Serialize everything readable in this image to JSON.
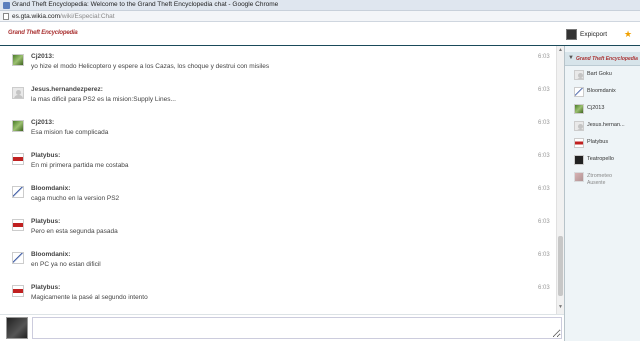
{
  "browser": {
    "title": "Grand Theft Encyclopedia: Welcome to the Grand Theft Encyclopedia chat - Google Chrome",
    "url_host": "es.gta.wikia.com",
    "url_path": "/wiki/Especial:Chat"
  },
  "header": {
    "logo_text": "Grand Theft Encyclopedia",
    "current_user": "Expicport"
  },
  "messages": [
    {
      "user": "Cj2013:",
      "text": "yo hize el modo Helicoptero y espere a los Cazas, los choque y destrui con misiles",
      "time": "6:03",
      "avatar": "av-cj"
    },
    {
      "user": "Jesus.hernandezperez:",
      "text": "la mas dificil para PS2 es la mision:Supply Lines...",
      "time": "6:03",
      "avatar": "av-default"
    },
    {
      "user": "Cj2013:",
      "text": "Esa mision fue complicada",
      "time": "6:03",
      "avatar": "av-cj"
    },
    {
      "user": "Platybus:",
      "text": "En mi primera partida me costaba",
      "time": "6:03",
      "avatar": "av-platy"
    },
    {
      "user": "Bloomdanix:",
      "text": "caga mucho en la version PS2",
      "time": "6:03",
      "avatar": "av-bloom"
    },
    {
      "user": "Platybus:",
      "text": "Pero en esta segunda pasada",
      "time": "6:03",
      "avatar": "av-platy"
    },
    {
      "user": "Bloomdanix:",
      "text": "en PC ya no estan dificil",
      "time": "6:03",
      "avatar": "av-bloom"
    },
    {
      "user": "Platybus:",
      "text": "Magicamente la pasé al segundo intento",
      "time": "6:03",
      "avatar": "av-platy"
    }
  ],
  "sidebar": {
    "room_label": "Grand Theft Encyclopedia",
    "users": [
      {
        "name": "Bart Goku",
        "avatar": "av-default",
        "status": ""
      },
      {
        "name": "Bloomdanix",
        "avatar": "av-bloom",
        "status": ""
      },
      {
        "name": "Cj2013",
        "avatar": "av-cj",
        "status": ""
      },
      {
        "name": "Jesus.hernan...",
        "avatar": "av-default",
        "status": ""
      },
      {
        "name": "Platybus",
        "avatar": "av-platy",
        "status": ""
      },
      {
        "name": "Teatropello",
        "avatar": "av-teatro",
        "status": ""
      },
      {
        "name": "Ztrometeo",
        "avatar": "av-ztro",
        "status": "Ausente"
      }
    ]
  },
  "input": {
    "placeholder": ""
  },
  "colors": {
    "header_border": "#1a4a5a",
    "sidebar_bg": "#eef4f7",
    "star": "#f0a000"
  }
}
